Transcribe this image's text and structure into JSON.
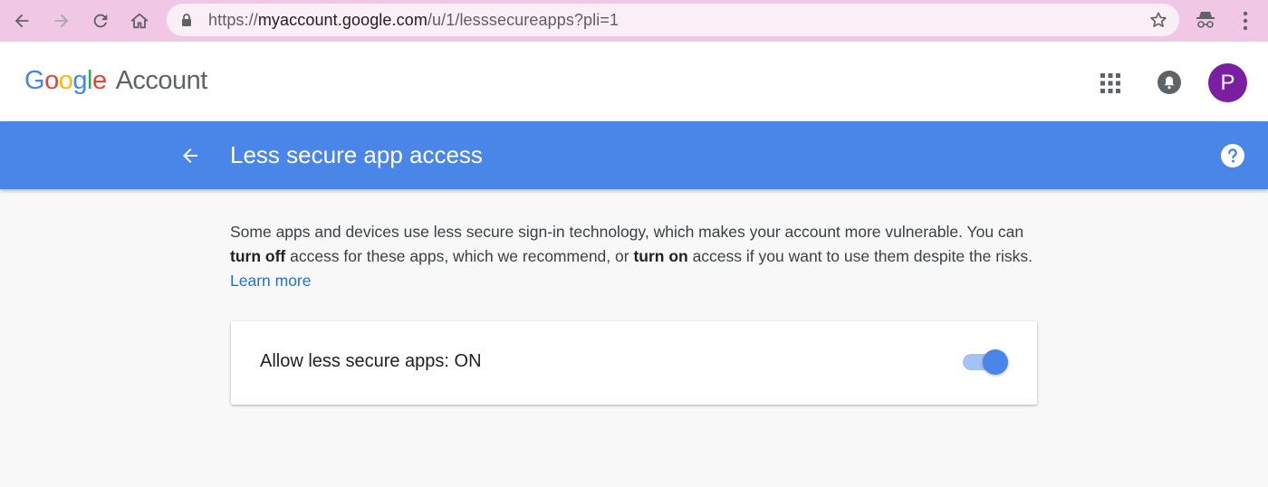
{
  "browser": {
    "url_scheme": "https://",
    "url_host": "myaccount.google.com",
    "url_path": "/u/1/lesssecureapps?pli=1",
    "icons": [
      "back-icon",
      "forward-icon",
      "reload-icon",
      "home-icon",
      "lock-icon",
      "star-icon",
      "incognito-icon"
    ]
  },
  "header": {
    "logo_text": [
      "G",
      "o",
      "o",
      "g",
      "l",
      "e"
    ],
    "product": "Account",
    "avatar_letter": "P",
    "avatar_color": "#7b1fa2",
    "icons": [
      "apps-grid-icon",
      "notifications-bell-icon"
    ]
  },
  "titlebar": {
    "title": "Less secure app access",
    "bar_color": "#4a86e8",
    "icons": [
      "back-arrow-icon",
      "help-icon"
    ]
  },
  "content": {
    "desc_part1": "Some apps and devices use less secure sign-in technology, which makes your account more vulnerable. You can ",
    "turn_off": "turn off",
    "desc_part2": " access for these apps, which we recommend, or ",
    "turn_on": "turn on",
    "desc_part3": " access if you want to use them despite the risks. ",
    "learn_more": "Learn more",
    "setting_label": "Allow less secure apps: ON",
    "toggle_state": "on"
  }
}
